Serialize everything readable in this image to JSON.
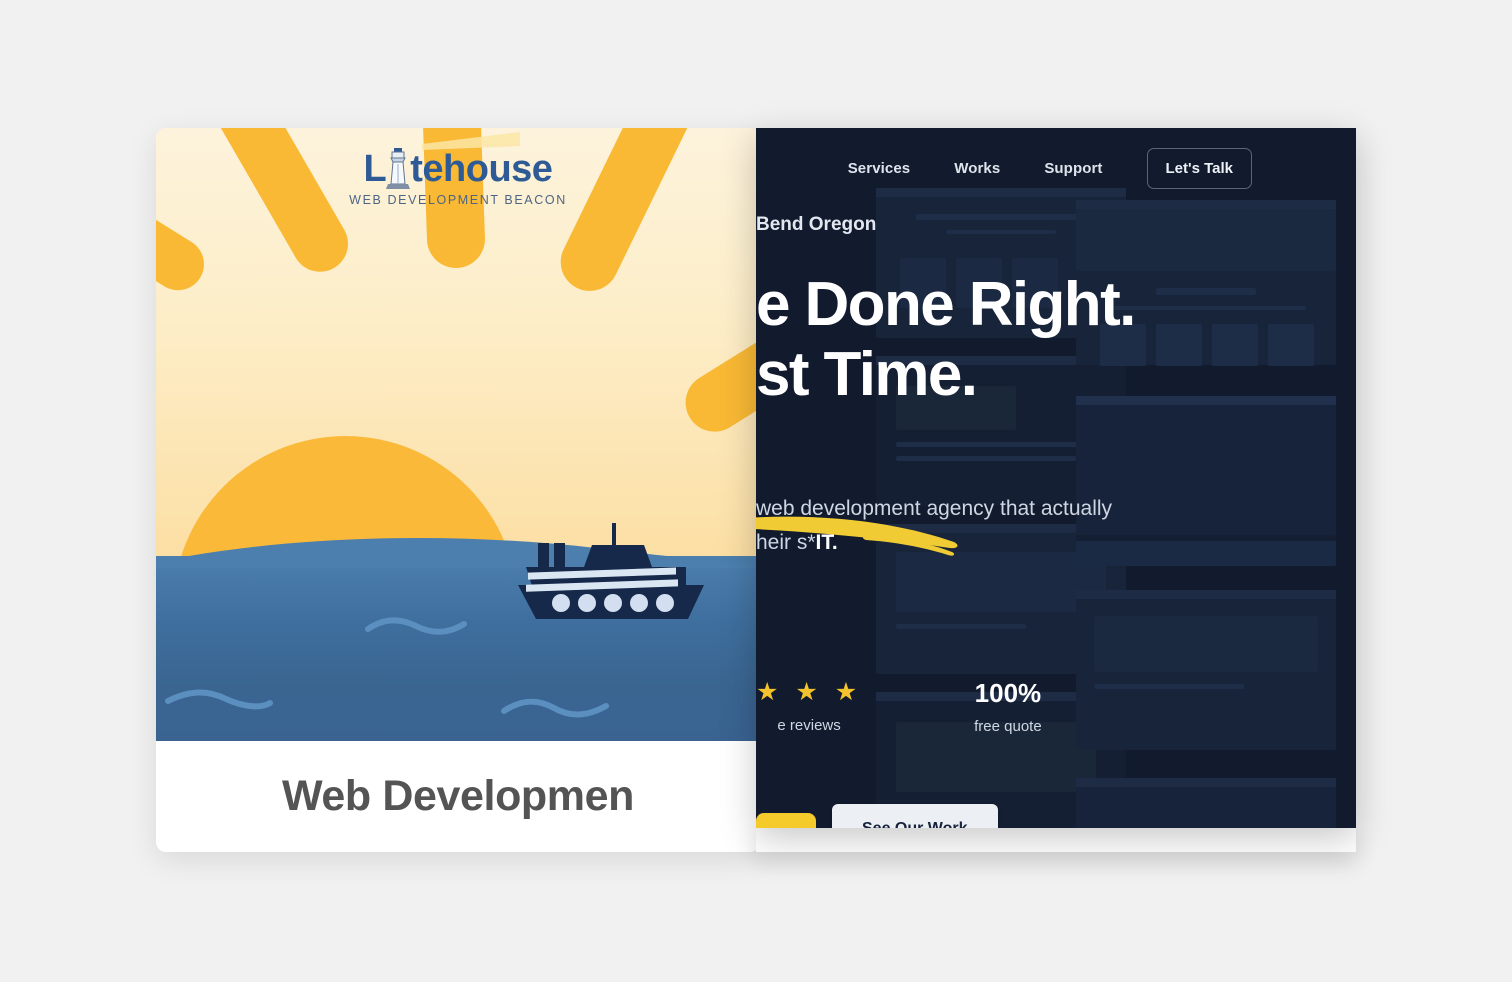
{
  "left_card": {
    "logo": {
      "brand": "Litehouse",
      "brand_prefix": "L",
      "brand_suffix": "tehouse",
      "tagline": "WEB DEVELOPMENT BEACON",
      "icon": "lighthouse-icon"
    },
    "illustration": {
      "name": "sunrise-ocean-cruise-ship",
      "sun_color": "#fbb93a",
      "ray_color": "#f9b934",
      "sky_gradient_top": "#fdf3dc",
      "sky_gradient_bottom": "#fbd27f",
      "water_top": "#4c7fae",
      "water_bottom": "#3a6391",
      "ship_color": "#16294a",
      "ship_stripe_color": "#dbe6f3",
      "porthole_count": 5
    },
    "title": "Web Developmen",
    "title_full": "Web Development"
  },
  "dark_card": {
    "background": "#111b2d",
    "nav": {
      "links": [
        {
          "label": "Services"
        },
        {
          "label": "Works"
        },
        {
          "label": "Support"
        }
      ],
      "cta": {
        "label": "Let's Talk"
      }
    },
    "hero": {
      "eyebrow": "Bend Oregon",
      "headline_line1": "e Done Right.",
      "headline_line2": "st Time.",
      "underline_color": "#f0cb33",
      "subtitle_line1": "web development agency that actually",
      "subtitle_line2_normal": "heir s*",
      "subtitle_line2_bold": "IT.",
      "stats": [
        {
          "icon": "star-rating",
          "stars": "★ ★ ★",
          "label": "e reviews"
        },
        {
          "value": "100%",
          "label": "free quote"
        }
      ],
      "buttons": {
        "primary": "",
        "secondary": "See Our Work"
      }
    }
  }
}
